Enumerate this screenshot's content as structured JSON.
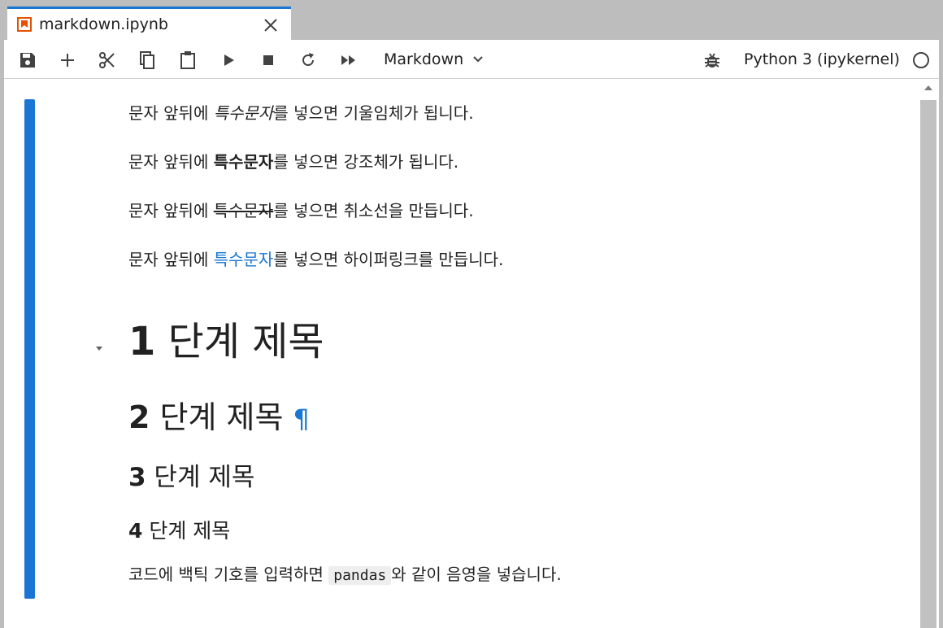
{
  "tab": {
    "title": "markdown.ipynb",
    "icon": "notebook-icon",
    "accent": "#1976d2",
    "icon_color": "#e65100"
  },
  "toolbar": {
    "celltype": "Markdown",
    "kernel": "Python 3 (ipykernel)",
    "buttons": [
      "save-icon",
      "add-icon",
      "cut-icon",
      "copy-icon",
      "paste-icon",
      "run-icon",
      "stop-icon",
      "restart-icon",
      "fast-forward-icon"
    ]
  },
  "cell": {
    "lines": [
      {
        "pre": "문자 앞뒤에 ",
        "styled": "특수문자",
        "post": "를 넣으면 기울임체가 됩니다."
      },
      {
        "pre": "문자 앞뒤에 ",
        "styled": "특수문자",
        "post": "를 넣으면 강조체가 됩니다."
      },
      {
        "pre": "문자 앞뒤에 ",
        "styled": "특수문자",
        "post": "를 넣으면 취소선을 만듭니다."
      },
      {
        "pre": "문자 앞뒤에 ",
        "styled": "특수문자",
        "post": "를 넣으면 하이퍼링크를 만듭니다."
      }
    ],
    "headings": [
      {
        "num": "1",
        "text": " 단계 제목"
      },
      {
        "num": "2",
        "text": " 단계 제목",
        "anchor": "¶"
      },
      {
        "num": "3",
        "text": " 단계 제목"
      },
      {
        "num": "4",
        "text": " 단계 제목"
      }
    ],
    "code_line": {
      "pre": "코드에 백틱 기호를 입력하면 ",
      "code": "pandas",
      "post": "와 같이 음영을 넣습니다."
    }
  }
}
